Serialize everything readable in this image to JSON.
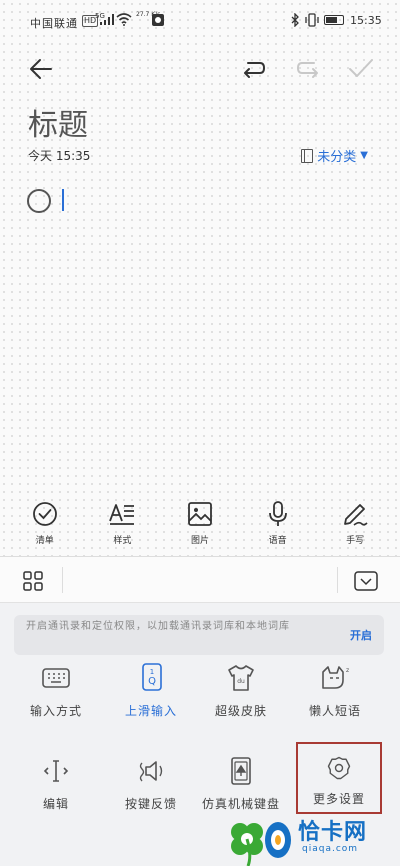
{
  "status_bar": {
    "carrier": "中国联通",
    "hd": "HD",
    "signal_label": "5G",
    "net_speed": "27.7 K/s",
    "time": "15:35"
  },
  "toolbar": {
    "icons": [
      "back-arrow-icon",
      "undo-icon",
      "redo-icon",
      "checkmark-icon"
    ]
  },
  "note": {
    "title": "标题",
    "meta_time": "今天 15:35",
    "category": "未分类"
  },
  "tools": [
    {
      "label": "清单",
      "icon": "checklist-icon"
    },
    {
      "label": "样式",
      "icon": "text-style-icon"
    },
    {
      "label": "图片",
      "icon": "image-icon"
    },
    {
      "label": "语音",
      "icon": "microphone-icon"
    },
    {
      "label": "手写",
      "icon": "handwriting-pen-icon"
    }
  ],
  "keyboard": {
    "permission_text": "开启通讯录和定位权限，以加载通讯录词库和本地词库",
    "permission_action": "开启",
    "options": [
      {
        "label": "输入方式",
        "icon": "keyboard-icon"
      },
      {
        "label": "上滑输入",
        "icon": "swipe-up-input-icon",
        "active": true
      },
      {
        "label": "超级皮肤",
        "icon": "tshirt-skin-icon"
      },
      {
        "label": "懒人短语",
        "icon": "lazy-cat-icon"
      },
      {
        "label": "编辑",
        "icon": "text-cursor-icon"
      },
      {
        "label": "按键反馈",
        "icon": "key-feedback-icon"
      },
      {
        "label": "仿真机械键盘",
        "icon": "mechanical-keyboard-icon"
      },
      {
        "label": "更多设置",
        "icon": "settings-gear-icon",
        "highlighted": true
      }
    ]
  },
  "watermark": {
    "name": "恰卡网",
    "url": "qiaqa.com"
  },
  "colors": {
    "accent": "#2a6fd6",
    "highlight_frame": "#a83a33",
    "watermark_blue": "#1670c4",
    "watermark_green": "#3aa935"
  }
}
